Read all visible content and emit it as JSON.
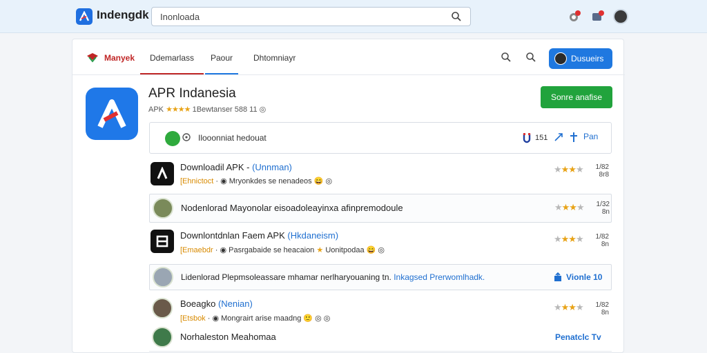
{
  "header": {
    "logo_text": "Indengdk",
    "search_value": "Inonloada"
  },
  "tabs": {
    "brand": "Manyek",
    "items": [
      "Ddemarlass",
      "Paour",
      "Dhtomniayr"
    ]
  },
  "user_button_label": "Dusueirs",
  "app": {
    "title": "APR Indanesia",
    "meta_prefix": "APK",
    "meta_rest": "1Bewtanser 588 11",
    "install_label": "Sonre anafise"
  },
  "download_bar": {
    "text": "Ilooonniat hedouat",
    "count": "151",
    "right_label": "Pan"
  },
  "rows": [
    {
      "title": "Downloadil APK -",
      "lang": "(Unnman)",
      "tag": "[Ehnictoct",
      "sub": "Mryonkdes se nenadeos",
      "num1": "1/82",
      "num2": "8r8"
    },
    {
      "title": "Nodenlorad Mayonolar eisoadoleayinxa afinpremodoule",
      "num1": "1/32",
      "num2": "8n"
    },
    {
      "title": "Downlontdnlan Faem APK",
      "lang": "(Hkdaneism)",
      "tag": "[Emaebdr",
      "sub": "Pasrgabaide se heacaion",
      "sub2": "Uonitpodaa",
      "num1": "1/82",
      "num2": "8n"
    },
    {
      "title": "Lidenlorad Plepmsoleassare mhamar nerlharyouaning tn.",
      "highlight": "Inkagsed Prerwomlhadk.",
      "link": "Vionle 10"
    },
    {
      "title": "Boeagko",
      "lang": "(Nenian)",
      "tag": "[Etsbok",
      "sub": "Mongrairt arise maadng",
      "num1": "1/82",
      "num2": "8n"
    },
    {
      "title": "Norhaleston Meahomaa",
      "link": "Penatclc Tv"
    }
  ]
}
